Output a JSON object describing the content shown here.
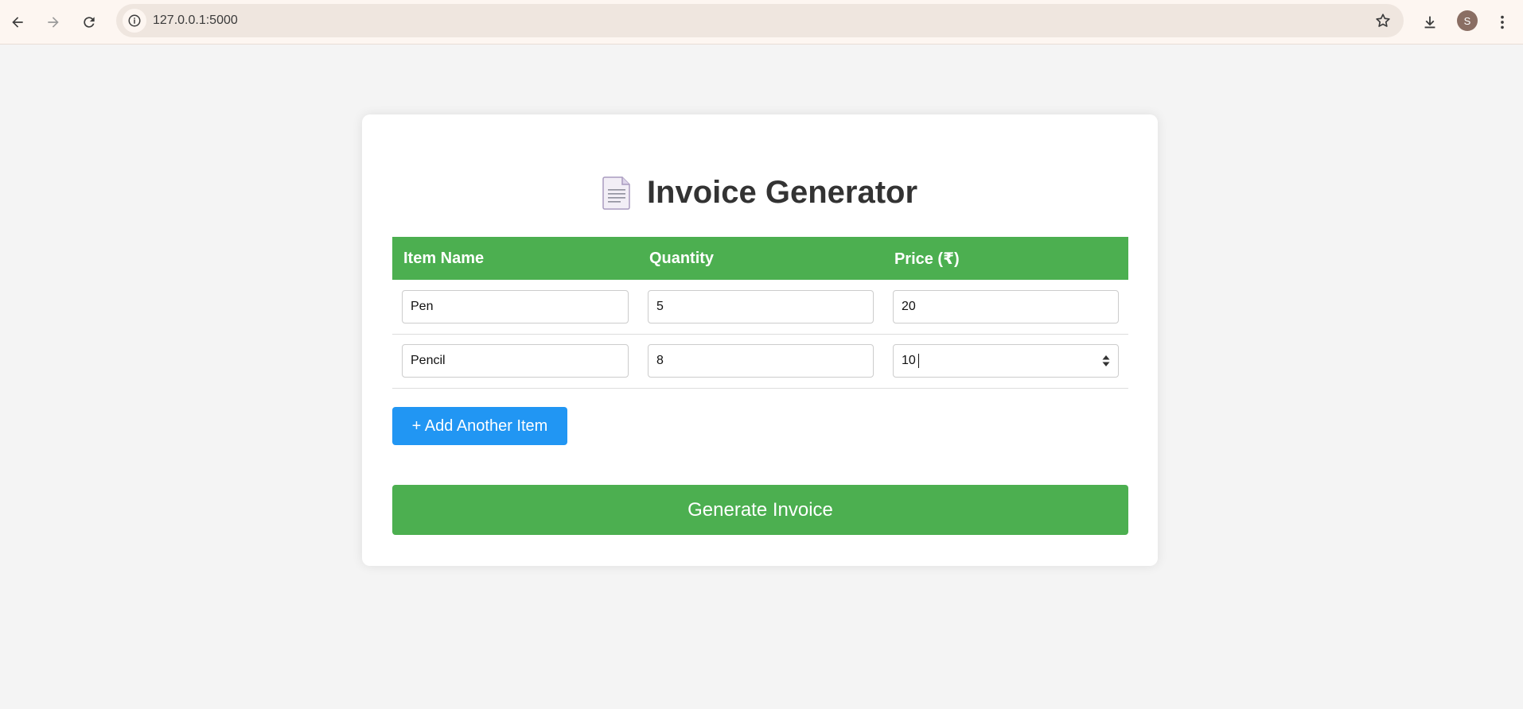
{
  "browser": {
    "url": "127.0.0.1:5000",
    "profile_initial": "S"
  },
  "page": {
    "title": "Invoice Generator",
    "title_icon": "document-icon"
  },
  "table": {
    "headers": [
      "Item Name",
      "Quantity",
      "Price (₹)"
    ],
    "rows": [
      {
        "name": "Pen",
        "quantity": "5",
        "price": "20"
      },
      {
        "name": "Pencil",
        "quantity": "8",
        "price": "10"
      }
    ]
  },
  "buttons": {
    "add_item": "+ Add Another Item",
    "generate": "Generate Invoice"
  },
  "colors": {
    "primary_green": "#4caf50",
    "accent_blue": "#2196f3",
    "background": "#f4f4f4"
  }
}
